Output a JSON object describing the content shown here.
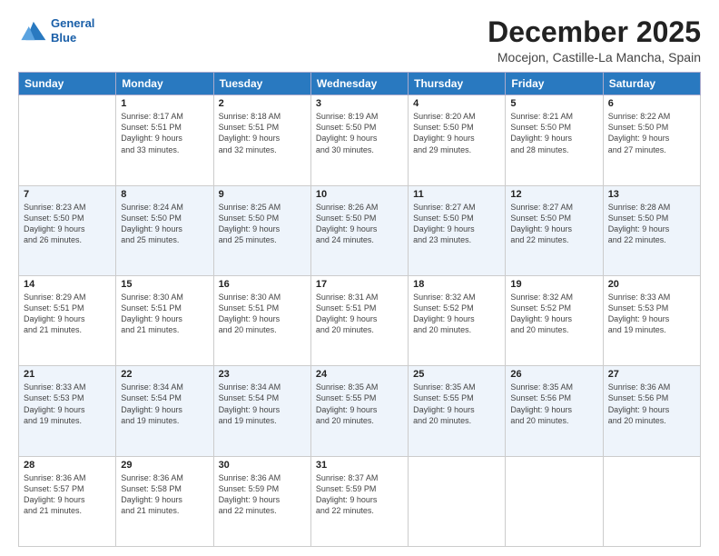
{
  "header": {
    "logo_line1": "General",
    "logo_line2": "Blue",
    "month": "December 2025",
    "location": "Mocejon, Castille-La Mancha, Spain"
  },
  "days": [
    "Sunday",
    "Monday",
    "Tuesday",
    "Wednesday",
    "Thursday",
    "Friday",
    "Saturday"
  ],
  "weeks": [
    [
      {
        "day": "",
        "info": ""
      },
      {
        "day": "1",
        "info": "Sunrise: 8:17 AM\nSunset: 5:51 PM\nDaylight: 9 hours\nand 33 minutes."
      },
      {
        "day": "2",
        "info": "Sunrise: 8:18 AM\nSunset: 5:51 PM\nDaylight: 9 hours\nand 32 minutes."
      },
      {
        "day": "3",
        "info": "Sunrise: 8:19 AM\nSunset: 5:50 PM\nDaylight: 9 hours\nand 30 minutes."
      },
      {
        "day": "4",
        "info": "Sunrise: 8:20 AM\nSunset: 5:50 PM\nDaylight: 9 hours\nand 29 minutes."
      },
      {
        "day": "5",
        "info": "Sunrise: 8:21 AM\nSunset: 5:50 PM\nDaylight: 9 hours\nand 28 minutes."
      },
      {
        "day": "6",
        "info": "Sunrise: 8:22 AM\nSunset: 5:50 PM\nDaylight: 9 hours\nand 27 minutes."
      }
    ],
    [
      {
        "day": "7",
        "info": "Sunrise: 8:23 AM\nSunset: 5:50 PM\nDaylight: 9 hours\nand 26 minutes."
      },
      {
        "day": "8",
        "info": "Sunrise: 8:24 AM\nSunset: 5:50 PM\nDaylight: 9 hours\nand 25 minutes."
      },
      {
        "day": "9",
        "info": "Sunrise: 8:25 AM\nSunset: 5:50 PM\nDaylight: 9 hours\nand 25 minutes."
      },
      {
        "day": "10",
        "info": "Sunrise: 8:26 AM\nSunset: 5:50 PM\nDaylight: 9 hours\nand 24 minutes."
      },
      {
        "day": "11",
        "info": "Sunrise: 8:27 AM\nSunset: 5:50 PM\nDaylight: 9 hours\nand 23 minutes."
      },
      {
        "day": "12",
        "info": "Sunrise: 8:27 AM\nSunset: 5:50 PM\nDaylight: 9 hours\nand 22 minutes."
      },
      {
        "day": "13",
        "info": "Sunrise: 8:28 AM\nSunset: 5:50 PM\nDaylight: 9 hours\nand 22 minutes."
      }
    ],
    [
      {
        "day": "14",
        "info": "Sunrise: 8:29 AM\nSunset: 5:51 PM\nDaylight: 9 hours\nand 21 minutes."
      },
      {
        "day": "15",
        "info": "Sunrise: 8:30 AM\nSunset: 5:51 PM\nDaylight: 9 hours\nand 21 minutes."
      },
      {
        "day": "16",
        "info": "Sunrise: 8:30 AM\nSunset: 5:51 PM\nDaylight: 9 hours\nand 20 minutes."
      },
      {
        "day": "17",
        "info": "Sunrise: 8:31 AM\nSunset: 5:51 PM\nDaylight: 9 hours\nand 20 minutes."
      },
      {
        "day": "18",
        "info": "Sunrise: 8:32 AM\nSunset: 5:52 PM\nDaylight: 9 hours\nand 20 minutes."
      },
      {
        "day": "19",
        "info": "Sunrise: 8:32 AM\nSunset: 5:52 PM\nDaylight: 9 hours\nand 20 minutes."
      },
      {
        "day": "20",
        "info": "Sunrise: 8:33 AM\nSunset: 5:53 PM\nDaylight: 9 hours\nand 19 minutes."
      }
    ],
    [
      {
        "day": "21",
        "info": "Sunrise: 8:33 AM\nSunset: 5:53 PM\nDaylight: 9 hours\nand 19 minutes."
      },
      {
        "day": "22",
        "info": "Sunrise: 8:34 AM\nSunset: 5:54 PM\nDaylight: 9 hours\nand 19 minutes."
      },
      {
        "day": "23",
        "info": "Sunrise: 8:34 AM\nSunset: 5:54 PM\nDaylight: 9 hours\nand 19 minutes."
      },
      {
        "day": "24",
        "info": "Sunrise: 8:35 AM\nSunset: 5:55 PM\nDaylight: 9 hours\nand 20 minutes."
      },
      {
        "day": "25",
        "info": "Sunrise: 8:35 AM\nSunset: 5:55 PM\nDaylight: 9 hours\nand 20 minutes."
      },
      {
        "day": "26",
        "info": "Sunrise: 8:35 AM\nSunset: 5:56 PM\nDaylight: 9 hours\nand 20 minutes."
      },
      {
        "day": "27",
        "info": "Sunrise: 8:36 AM\nSunset: 5:56 PM\nDaylight: 9 hours\nand 20 minutes."
      }
    ],
    [
      {
        "day": "28",
        "info": "Sunrise: 8:36 AM\nSunset: 5:57 PM\nDaylight: 9 hours\nand 21 minutes."
      },
      {
        "day": "29",
        "info": "Sunrise: 8:36 AM\nSunset: 5:58 PM\nDaylight: 9 hours\nand 21 minutes."
      },
      {
        "day": "30",
        "info": "Sunrise: 8:36 AM\nSunset: 5:59 PM\nDaylight: 9 hours\nand 22 minutes."
      },
      {
        "day": "31",
        "info": "Sunrise: 8:37 AM\nSunset: 5:59 PM\nDaylight: 9 hours\nand 22 minutes."
      },
      {
        "day": "",
        "info": ""
      },
      {
        "day": "",
        "info": ""
      },
      {
        "day": "",
        "info": ""
      }
    ]
  ]
}
